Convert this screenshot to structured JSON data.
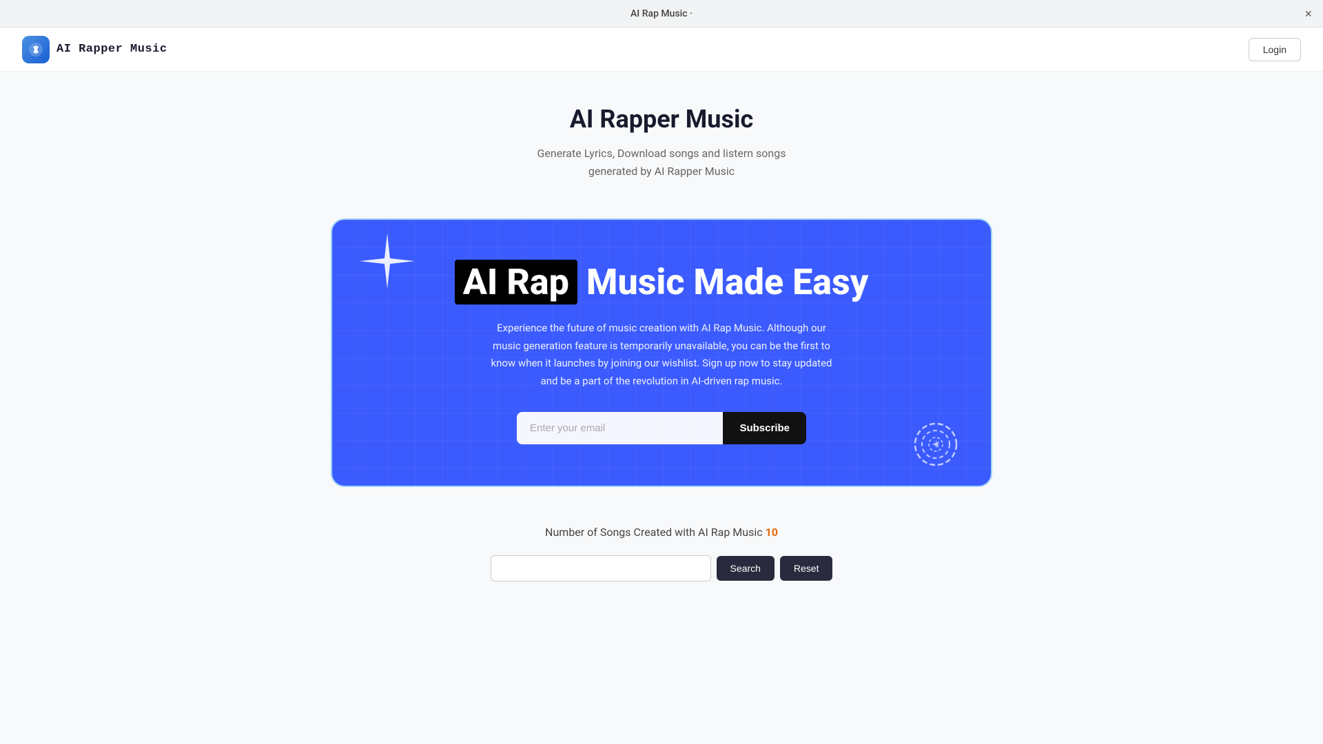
{
  "browser": {
    "title": "AI Rap Music ·",
    "close_label": "×"
  },
  "navbar": {
    "logo_icon": "✦",
    "brand_name": "AI Rapper Music",
    "login_label": "Login"
  },
  "hero": {
    "title": "AI Rapper Music",
    "subtitle_line1": "Generate Lyrics, Download songs and listern songs",
    "subtitle_line2": "generated by AI Rapper Music"
  },
  "banner": {
    "headline_part1": "AI Rap",
    "headline_part2": "Music Made Easy",
    "description": "Experience the future of music creation with AI Rap Music. Although our music generation feature is temporarily unavailable, you can be the first to know when it launches by joining our wishlist. Sign up now to stay updated and be a part of the revolution in AI-driven rap music.",
    "email_placeholder": "Enter your email",
    "subscribe_label": "Subscribe"
  },
  "songs_section": {
    "count_text_prefix": "Number of Songs Created with AI Rap Music",
    "count_number": "10"
  },
  "search_section": {
    "search_placeholder": "",
    "search_button_label": "Search",
    "reset_button_label": "Reset"
  },
  "colors": {
    "banner_bg": "#3b5bff",
    "accent_orange": "#e6690a",
    "dark_button": "#2a2a3e"
  }
}
